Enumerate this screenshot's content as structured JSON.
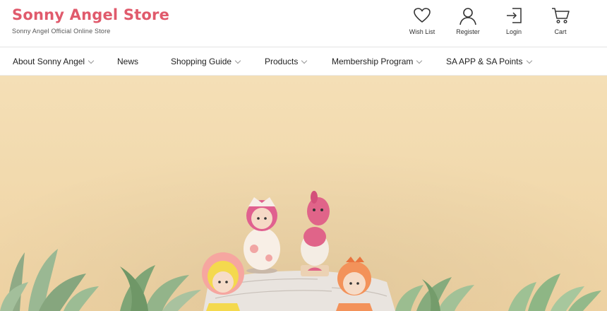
{
  "brand": {
    "title": "Sonny Angel Store",
    "subtitle": "Sonny Angel Official Online Store",
    "color": "#e05a6c"
  },
  "header_icons": [
    {
      "label": "Wish List",
      "icon": "heart-icon"
    },
    {
      "label": "Register",
      "icon": "person-icon"
    },
    {
      "label": "Login",
      "icon": "login-icon"
    },
    {
      "label": "Cart",
      "icon": "cart-icon"
    }
  ],
  "nav": [
    {
      "label": "About Sonny Angel",
      "has_dropdown": true
    },
    {
      "label": "News",
      "has_dropdown": false
    },
    {
      "label": "Shopping Guide",
      "has_dropdown": true
    },
    {
      "label": "Products",
      "has_dropdown": true
    },
    {
      "label": "Membership Program",
      "has_dropdown": true
    },
    {
      "label": "SA APP & SA Points",
      "has_dropdown": true
    }
  ],
  "hero": {
    "background": "#f3dcb0"
  }
}
